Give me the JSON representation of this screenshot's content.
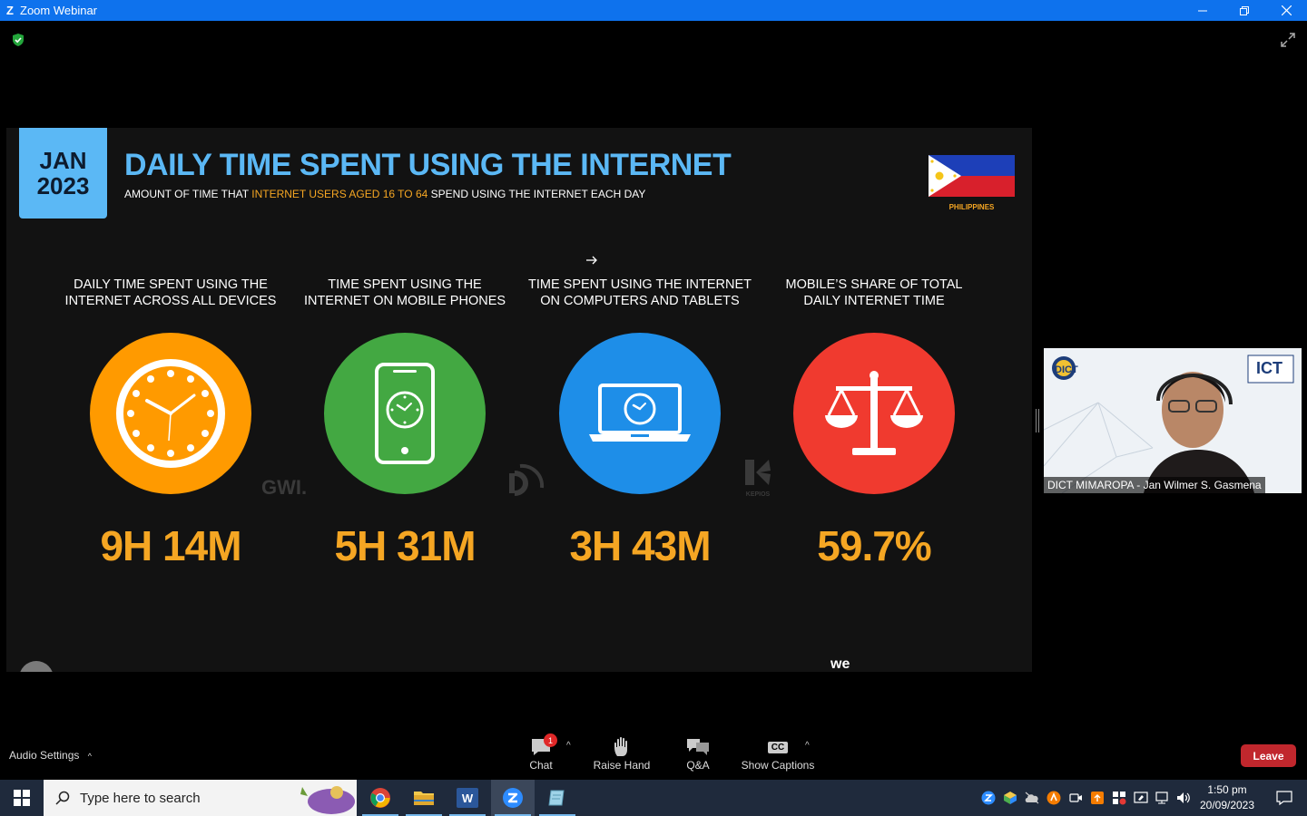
{
  "window": {
    "app_logo": "Z",
    "title": "Zoom Webinar",
    "minimize_icon": "minimize-icon",
    "restore_icon": "restore-icon",
    "close_icon": "close-icon"
  },
  "slide": {
    "date_month": "JAN",
    "date_year": "2023",
    "title": "DAILY TIME SPENT USING THE INTERNET",
    "subtitle_pre": "AMOUNT OF TIME THAT ",
    "subtitle_highlight": "INTERNET USERS AGED 16 TO 64",
    "subtitle_post": " SPEND USING THE INTERNET EACH DAY",
    "flag_label": "PHILIPPINES",
    "brand": "we",
    "watermarks": {
      "gwi": "GWI.",
      "kepios": "KEPIOS"
    },
    "stats": [
      {
        "label_line1": "DAILY TIME SPENT USING THE",
        "label_line2": "INTERNET ACROSS ALL DEVICES",
        "value": "9H 14M",
        "color": "#ff9a00",
        "icon": "clock-icon"
      },
      {
        "label_line1": "TIME SPENT USING THE",
        "label_line2": "INTERNET ON MOBILE PHONES",
        "value": "5H 31M",
        "color": "#43a842",
        "icon": "mobile-phone-icon"
      },
      {
        "label_line1": "TIME SPENT USING THE INTERNET",
        "label_line2": "ON COMPUTERS AND TABLETS",
        "value": "3H 43M",
        "color": "#1e8ee8",
        "icon": "laptop-icon"
      },
      {
        "label_line1": "MOBILE’S SHARE OF TOTAL",
        "label_line2": "DAILY INTERNET TIME",
        "value": "59.7%",
        "color": "#f03a2f",
        "icon": "balance-scale-icon"
      }
    ],
    "accent_blue": "#5bb8f5",
    "accent_orange": "#f5a623"
  },
  "video": {
    "participant_name": "DICT MIMAROPA - Jan Wilmer S. Gasmena",
    "logo_left": "DICT",
    "logo_right": "ICT"
  },
  "toolbar": {
    "audio_settings": "Audio Settings",
    "chat_label": "Chat",
    "chat_badge": "1",
    "raise_hand_label": "Raise Hand",
    "qa_label": "Q&A",
    "captions_label": "Show Captions",
    "captions_icon_text": "CC",
    "leave_label": "Leave"
  },
  "taskbar": {
    "search_placeholder": "Type here to search",
    "apps": [
      "chrome-icon",
      "file-explorer-icon",
      "word-icon",
      "zoom-icon",
      "notepad-icon"
    ],
    "word_icon_text": "W",
    "time": "1:50 pm",
    "date": "20/09/2023"
  }
}
